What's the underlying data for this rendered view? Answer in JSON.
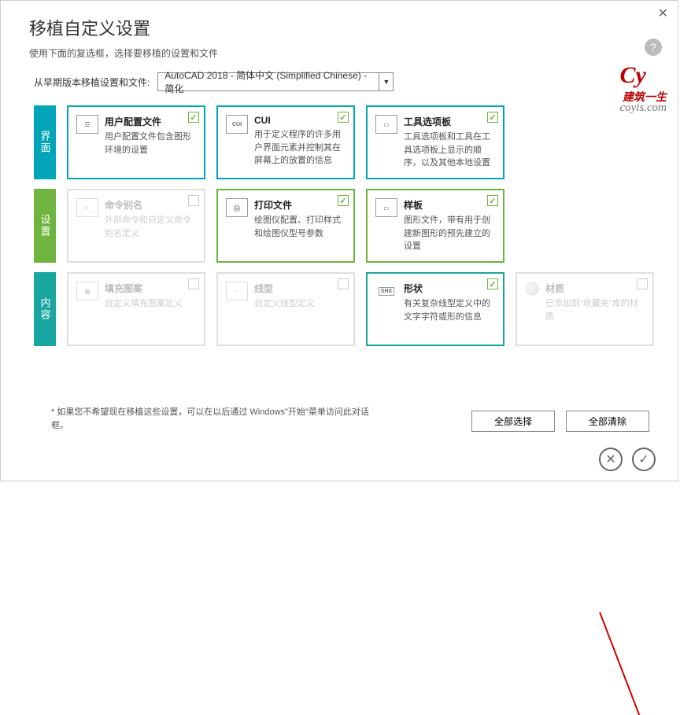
{
  "window": {
    "title": "移植自定义设置",
    "subtitle": "使用下面的复选框，选择要移植的设置和文件"
  },
  "source": {
    "label": "从早期版本移植设置和文件:",
    "value": "AutoCAD 2018 - 简体中文 (Simplified Chinese) - 简化"
  },
  "sections": {
    "ui": {
      "tab": "界面",
      "cards": [
        {
          "title": "用户配置文件",
          "desc": "用户配置文件包含图形环境的设置",
          "checked": true
        },
        {
          "title": "CUI",
          "desc": "用于定义程序的许多用户界面元素并控制其在屏幕上的放置的信息",
          "checked": true,
          "icon": "CUI"
        },
        {
          "title": "工具选项板",
          "desc": "工具选项板和工具在工具选项板上显示的顺序，以及其他本地设置",
          "checked": true
        }
      ]
    },
    "set": {
      "tab": "设置",
      "cards": [
        {
          "title": "命令别名",
          "desc": "外部命令和自定义命令别名定义",
          "checked": false,
          "disabled": true
        },
        {
          "title": "打印文件",
          "desc": "绘图仪配置、打印样式和绘图仪型号参数",
          "checked": true
        },
        {
          "title": "样板",
          "desc": "图形文件，带有用于创建新图形的预先建立的设置",
          "checked": true
        }
      ]
    },
    "cnt": {
      "tab": "内容",
      "cards": [
        {
          "title": "填充图案",
          "desc": "自定义填充图案定义",
          "checked": false,
          "disabled": true
        },
        {
          "title": "线型",
          "desc": "自定义线型定义",
          "checked": false,
          "disabled": true
        },
        {
          "title": "形状",
          "desc": "有关复杂线型定义中的文字字符或形的信息",
          "checked": true,
          "icon": "SHX"
        },
        {
          "title": "材质",
          "desc": "已添加到\"收藏夹\"库的材质",
          "checked": false,
          "disabled": true,
          "icon": "ball"
        }
      ]
    }
  },
  "footnote": "* 如果您不希望现在移植这些设置，可以在以后通过 Windows\"开始\"菜单访问此对话框。",
  "buttons": {
    "selectAll": "全部选择",
    "clearAll": "全部清除"
  },
  "watermark": {
    "logo": "Cy",
    "line1": "建筑一生",
    "line2": "coyis.com"
  }
}
